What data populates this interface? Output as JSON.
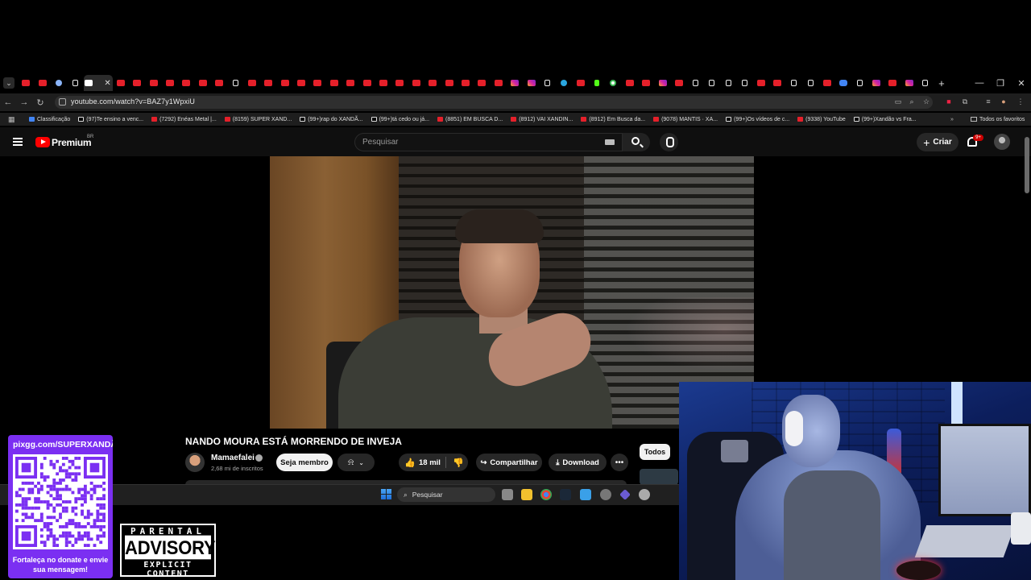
{
  "browser": {
    "url": "youtube.com/watch?v=BAZ7y1WpxiU",
    "tabs": [
      "yt",
      "yt",
      "lnk",
      "tt",
      "wh",
      "yt",
      "yt",
      "yt",
      "yt",
      "yt",
      "yt",
      "yt",
      "tt",
      "yt",
      "yt",
      "yt",
      "yt",
      "yt",
      "yt",
      "yt",
      "yt",
      "yt",
      "yt",
      "yt",
      "yt",
      "yt",
      "yt",
      "yt",
      "yt",
      "ig",
      "ig",
      "tt",
      "tg",
      "yt",
      "kk",
      "gg",
      "yt",
      "yt",
      "ig",
      "yt",
      "tt",
      "tt",
      "tt",
      "tt",
      "yt",
      "yt",
      "tt",
      "tt",
      "yt",
      "dc",
      "tt",
      "ig",
      "yt",
      "ig",
      "tt"
    ],
    "new_tab_label": "+",
    "bookmarks": [
      {
        "label": "Classificação",
        "color": "#4285f4"
      },
      {
        "label": "(97)Te ensino a venc...",
        "color": "#000000"
      },
      {
        "label": "(7292) Enéas Metal |...",
        "color": "#e5202a"
      },
      {
        "label": "(8159) SUPER XAND...",
        "color": "#e5202a"
      },
      {
        "label": "(99+)rap do XANDÃ...",
        "color": "#000000"
      },
      {
        "label": "(99+)tá cedo ou já...",
        "color": "#000000"
      },
      {
        "label": "(8851) EM BUSCA D...",
        "color": "#e5202a"
      },
      {
        "label": "(8912) VAI XANDIN...",
        "color": "#e5202a"
      },
      {
        "label": "(8912) Em Busca da...",
        "color": "#e5202a"
      },
      {
        "label": "(9078) MANTIS · XA...",
        "color": "#e5202a"
      },
      {
        "label": "(99+)Os vídeos de c...",
        "color": "#000000"
      },
      {
        "label": "(9338) YouTube",
        "color": "#e5202a"
      },
      {
        "label": "(99+)Xandão vs Fra...",
        "color": "#000000"
      }
    ],
    "all_favorites": "Todos os favoritos"
  },
  "youtube": {
    "logo_text": "Premium",
    "country": "BR",
    "search_placeholder": "Pesquisar",
    "create_label": "Criar",
    "notifications_badge": "9+",
    "video": {
      "title": "NANDO MOURA ESTÁ MORRENDO DE INVEJA",
      "channel": "Mamaefalei",
      "subscribers": "2,68 mi de inscritos",
      "member_label": "Seja membro",
      "likes": "18 mil",
      "share_label": "Compartilhar",
      "download_label": "Download",
      "more_label": "•••"
    },
    "filter_chip": "Todos"
  },
  "taskbar": {
    "search_label": "Pesquisar"
  },
  "overlay": {
    "donate_url": "pixgg.com/SUPERXANDÃO",
    "donate_caption": "Fortaleça no donate e envie sua mensagem!",
    "advisory_top": "PARENTAL",
    "advisory_mid": "ADVISORY",
    "advisory_bot": "EXPLICIT CONTENT"
  },
  "colors": {
    "yt_red": "#ff0000",
    "donate_purple": "#7b2ff2",
    "dark_bg": "#0f0f0f"
  }
}
